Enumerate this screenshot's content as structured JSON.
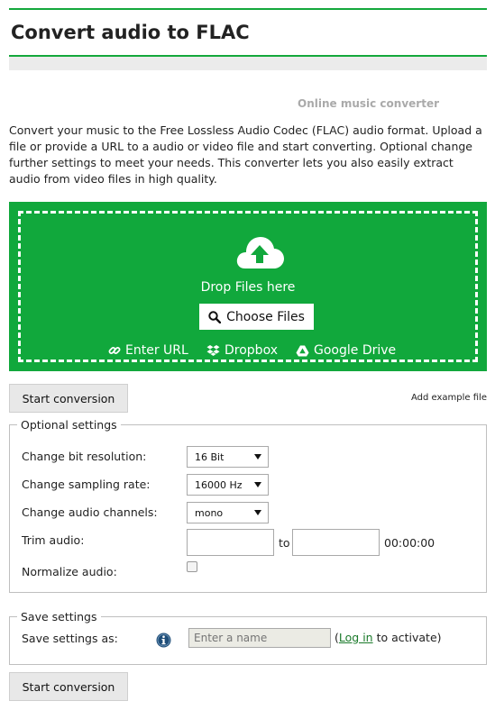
{
  "header": {
    "title": "Convert audio to FLAC",
    "subtitle": "Online music converter"
  },
  "intro": "Convert your music to the Free Lossless Audio Codec (FLAC) audio format. Upload a file or provide a URL to a audio or video file and start converting. Optional change further settings to meet your needs. This converter lets you also easily extract audio from video files in high quality.",
  "upload": {
    "drop_text": "Drop Files here",
    "choose_label": "Choose Files",
    "enter_url": "Enter URL",
    "dropbox": "Dropbox",
    "google_drive": "Google Drive"
  },
  "actions": {
    "start_label": "Start conversion",
    "example_link": "Add example file"
  },
  "optional": {
    "legend": "Optional settings",
    "bit_resolution": {
      "label": "Change bit resolution:",
      "value": "16 Bit"
    },
    "sampling_rate": {
      "label": "Change sampling rate:",
      "value": "16000 Hz"
    },
    "channels": {
      "label": "Change audio channels:",
      "value": "mono"
    },
    "trim": {
      "label": "Trim audio:",
      "to": "to",
      "time": "00:00:00"
    },
    "normalize": {
      "label": "Normalize audio:",
      "checked": false
    }
  },
  "save": {
    "legend": "Save settings",
    "label": "Save settings as:",
    "placeholder": "Enter a name",
    "login_prefix": "(",
    "login_link": "Log in",
    "login_suffix": " to activate)"
  },
  "colors": {
    "accent": "#14a83c",
    "dropzone": "#11a83c",
    "info_icon": "#1f4e79",
    "link": "#1a7a2a"
  },
  "icons": {
    "upload": "cloud-upload-icon",
    "search": "search-icon",
    "link": "link-icon",
    "dropbox": "dropbox-icon",
    "drive": "google-drive-icon",
    "info": "info-icon"
  }
}
